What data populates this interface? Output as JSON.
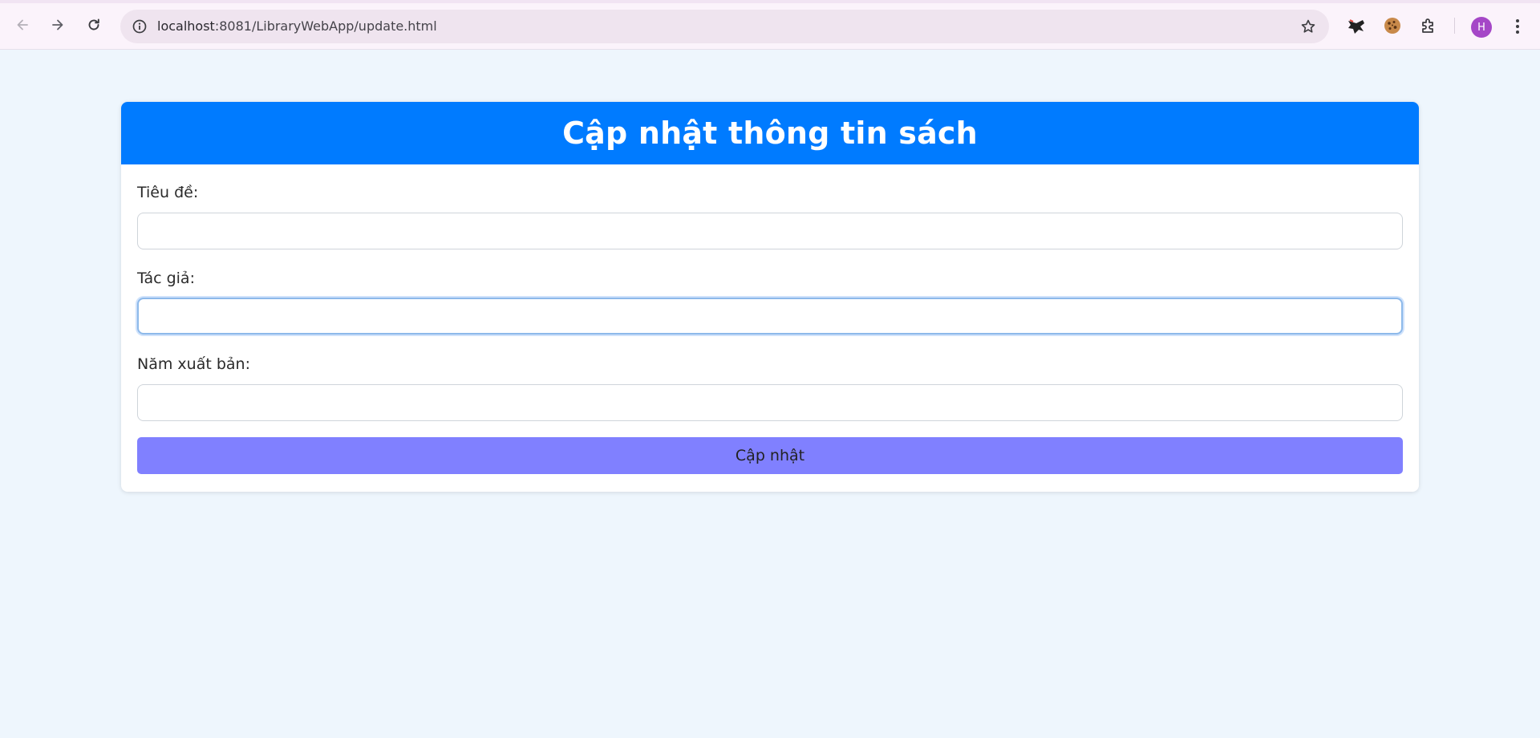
{
  "browser": {
    "url_host": "localhost",
    "url_rest": ":8081/LibraryWebApp/update.html",
    "profile_initial": "H",
    "icons": {
      "back": "arrow-left-icon",
      "forward": "arrow-right-icon",
      "reload": "reload-icon",
      "site_info": "info-icon",
      "bookmark": "star-icon",
      "extension_1": "extension-icon",
      "extension_2": "cookie-icon",
      "extensions": "puzzle-icon",
      "menu": "more-vertical-icon"
    }
  },
  "page": {
    "title": "Cập nhật thông tin sách",
    "fields": [
      {
        "label": "Tiêu đề:",
        "value": "",
        "placeholder": ""
      },
      {
        "label": "Tác giả:",
        "value": "",
        "placeholder": ""
      },
      {
        "label": "Năm xuất bản:",
        "value": "",
        "placeholder": ""
      }
    ],
    "submit_label": "Cập nhật"
  },
  "colors": {
    "header_bg": "#007bff",
    "button_bg": "#8080ff",
    "page_bg": "#eef6fd",
    "avatar_bg": "#a547c7"
  }
}
